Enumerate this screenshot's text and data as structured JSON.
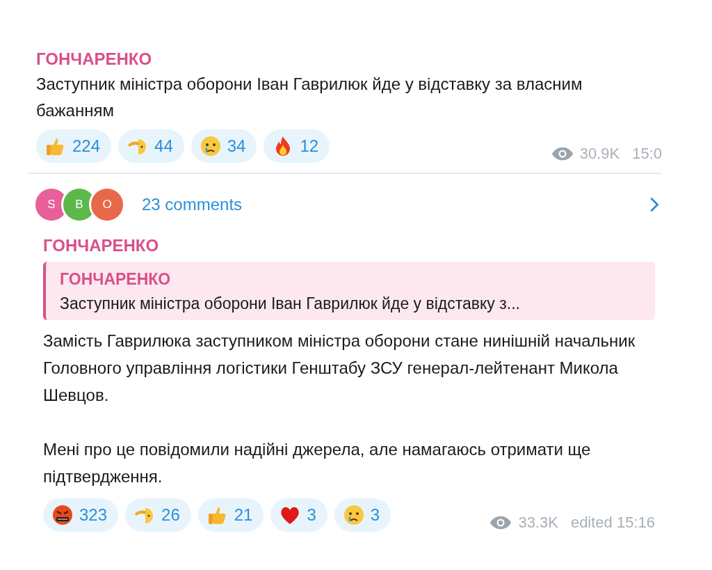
{
  "post": {
    "author": "ГОНЧАРЕНКО",
    "text": "Заступник міністра оборони Іван Гаврилюк йде у відставку за власним бажанням",
    "reactions": [
      {
        "kind": "thumbs",
        "count": "224"
      },
      {
        "kind": "salute",
        "count": "44"
      },
      {
        "kind": "cry",
        "count": "34"
      },
      {
        "kind": "fire",
        "count": "12"
      }
    ],
    "views": "30.9K",
    "time": "15:0"
  },
  "comments": {
    "avatars": [
      {
        "letter": "S",
        "color": "#e8609a"
      },
      {
        "letter": "B",
        "color": "#5cb84a"
      },
      {
        "letter": "O",
        "color": "#e8684a"
      }
    ],
    "label": "23 comments"
  },
  "reply": {
    "author": "ГОНЧАРЕНКО",
    "quote": {
      "author": "ГОНЧАРЕНКО",
      "text": "Заступник міністра оборони Іван Гаврилюк йде у відставку з..."
    },
    "paragraphs": [
      "Замість Гаврилюка заступником міністра оборони стане нинішній начальник Головного управління логістики Генштабу ЗСУ генерал-лейтенант Микола Шевцов.",
      "Мені про це повідомили надійні джерела, але намагаюсь отримати ще підтвердження."
    ],
    "reactions": [
      {
        "kind": "angry",
        "count": "323"
      },
      {
        "kind": "salute",
        "count": "26"
      },
      {
        "kind": "thumbs",
        "count": "21"
      },
      {
        "kind": "heart",
        "count": "3"
      },
      {
        "kind": "cry",
        "count": "3"
      }
    ],
    "views": "33.3K",
    "time": "edited 15:16"
  }
}
